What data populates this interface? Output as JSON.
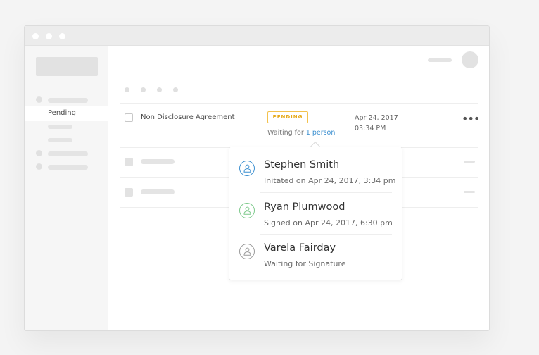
{
  "window": {
    "traffic_lights": [
      "close",
      "minimize",
      "maximize"
    ]
  },
  "sidebar": {
    "active_item_label": "Pending"
  },
  "document_row": {
    "name": "Non Disclosure Agreement",
    "status_badge": "PENDING",
    "waiting_prefix": "Waiting for ",
    "waiting_link": "1 person",
    "date": "Apr 24, 2017",
    "time": "03:34 PM",
    "more_label": "•••"
  },
  "popover": {
    "signers": [
      {
        "name": "Stephen Smith",
        "status": "Initated on Apr 24, 2017, 3:34 pm",
        "color": "#3b8fd0"
      },
      {
        "name": "Ryan Plumwood",
        "status": "Signed on Apr 24, 2017, 6:30 pm",
        "color": "#7cc98a"
      },
      {
        "name": "Varela Fairday",
        "status": "Waiting for Signature",
        "color": "#9a9a9a"
      }
    ]
  },
  "colors": {
    "accent_link": "#3b8fd0",
    "pending_badge": "#e6a817",
    "signed_green": "#7cc98a",
    "placeholder_gray": "#e2e2e2"
  }
}
